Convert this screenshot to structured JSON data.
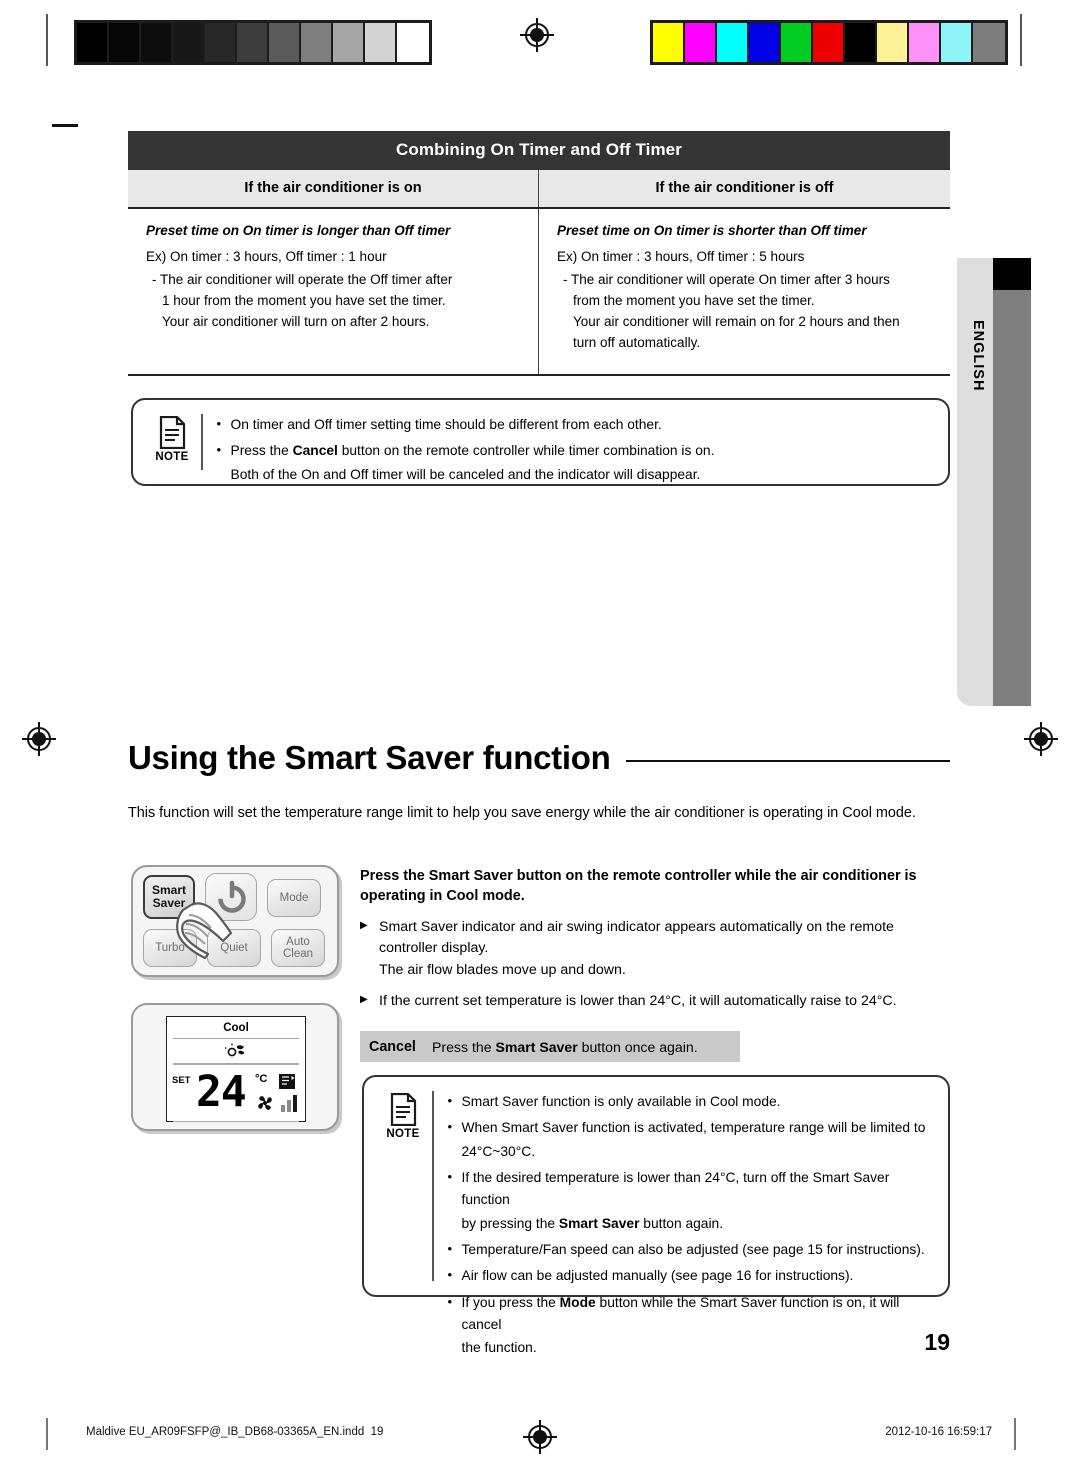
{
  "print_marks": {
    "grayscale_swatches": [
      "#000000",
      "#050505",
      "#0d0d0d",
      "#181818",
      "#272727",
      "#3c3c3c",
      "#5a5a5a",
      "#7e7e7e",
      "#a5a5a5",
      "#d3d3d3",
      "#ffffff"
    ],
    "color_swatches": [
      "#ffff00",
      "#ff00ff",
      "#00ffff",
      "#0000e8",
      "#00cc22",
      "#ee0000",
      "#000000",
      "#fdf396",
      "#fc92f8",
      "#8ef4f7",
      "#7d7d7d"
    ]
  },
  "side_tab": {
    "language": "ENGLISH"
  },
  "table": {
    "title": "Combining On Timer and Off Timer",
    "columns": [
      {
        "header": "If the air conditioner is on",
        "subtitle": "Preset time on On timer is longer than Off timer",
        "example": "Ex) On timer : 3 hours, Off timer : 1 hour",
        "detail": [
          "- The air conditioner will operate the Off timer after",
          "1 hour from the moment you have set the timer.",
          "Your air conditioner will turn on after 2 hours."
        ]
      },
      {
        "header": "If the air conditioner is off",
        "subtitle": "Preset time on On timer is shorter than Off timer",
        "example": "Ex) On timer : 3 hours, Off timer : 5 hours",
        "detail": [
          "- The air conditioner will operate On timer after 3 hours",
          "from the moment you have set the timer.",
          "Your air conditioner will remain on for 2 hours and then",
          "turn off automatically."
        ]
      }
    ]
  },
  "note_top": {
    "label": "NOTE",
    "items": [
      {
        "text": "On timer and Off timer setting time should be different from each other."
      },
      {
        "pre": "Press the ",
        "bold": "Cancel",
        "post": " button on the remote controller while timer combination is on."
      },
      {
        "cont": "Both of the On and Off timer will be canceled and the indicator will disappear."
      }
    ]
  },
  "section": {
    "heading": "Using the Smart Saver function",
    "intro": "This function will set the temperature range limit to help you save energy while the air conditioner is operating in Cool mode."
  },
  "remote": {
    "buttons": [
      {
        "label": "Smart\nSaver",
        "name": "smart-saver-button",
        "highlighted": true
      },
      {
        "label": "Mode",
        "name": "mode-button"
      },
      {
        "label": "Turbo",
        "name": "turbo-button"
      },
      {
        "label": "Quiet",
        "name": "quiet-button"
      },
      {
        "label": "Auto\nClean",
        "name": "auto-clean-button"
      }
    ],
    "power_icon": "power-icon",
    "hand_icon": "pointing-hand-icon"
  },
  "lcd": {
    "mode": "Cool",
    "smart_saver_icon": "smart-saver-indicator-icon",
    "set_label": "SET",
    "temperature": "24",
    "unit": "°C",
    "swing_icon": "air-swing-indicator-icon",
    "fan_icon": "fan-icon",
    "fan_bars": 3
  },
  "instructions": {
    "lead": {
      "pre": "Press the ",
      "bold": "Smart Saver",
      "post": " button on the remote controller while the air conditioner is operating in Cool mode."
    },
    "bullets": [
      {
        "marker": "▶",
        "lines": [
          "Smart Saver indicator and air swing indicator appears automatically on the remote",
          "controller display."
        ]
      },
      {
        "marker": "",
        "lines": [
          "The air flow blades move up and down."
        ]
      },
      {
        "marker": "▶",
        "lines": [
          "If the current set temperature is lower than 24°C, it will automatically raise to 24°C."
        ]
      }
    ]
  },
  "cancel_row": {
    "key": "Cancel",
    "pre": "Press the ",
    "bold": "Smart Saver",
    "post": " button once again."
  },
  "note_bottom": {
    "label": "NOTE",
    "items": [
      {
        "text": "Smart Saver function is only available in Cool mode."
      },
      {
        "text": "When Smart Saver function is activated, temperature range will be limited to"
      },
      {
        "cont": "24°C~30°C."
      },
      {
        "pre": "If the desired temperature is lower than 24°C, turn off the Smart Saver function",
        "post": ""
      },
      {
        "cont2_pre": "by pressing the ",
        "cont2_bold": "Smart Saver",
        "cont2_post": " button again."
      },
      {
        "text": "Temperature/Fan speed can also be adjusted (see page 15 for instructions)."
      },
      {
        "text": "Air flow can be adjusted manually (see page 16 for instructions)."
      },
      {
        "pre2": "If you press the ",
        "bold2": "Mode",
        "post2": " button while the Smart Saver function is on, it will cancel"
      },
      {
        "cont": "the function."
      }
    ]
  },
  "page_number": "19",
  "footer": {
    "file": "Maldive EU_AR09FSFP@_IB_DB68-03365A_EN.indd",
    "page": "19",
    "timestamp": "2012-10-16   16:59:17"
  }
}
